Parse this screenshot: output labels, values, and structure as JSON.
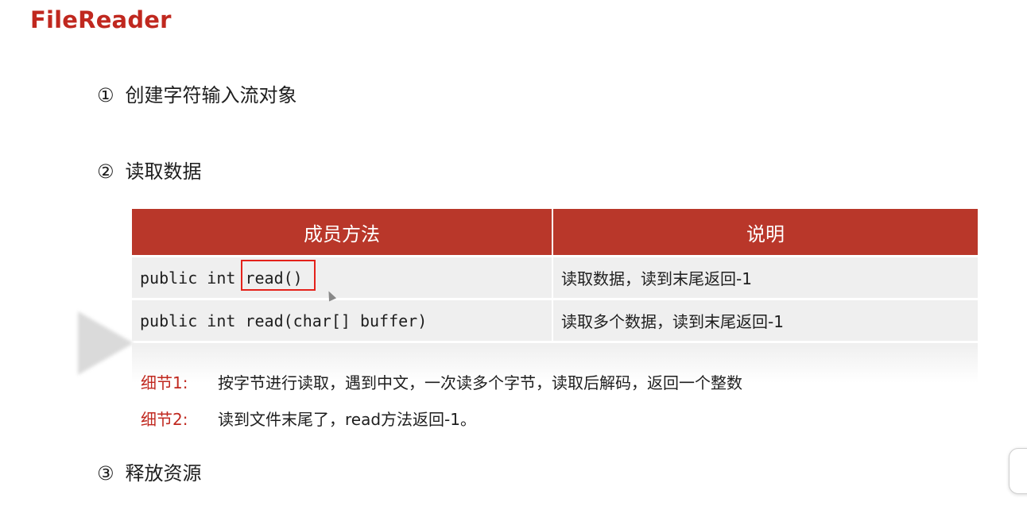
{
  "title": "FileReader",
  "steps": [
    {
      "num": "①",
      "text": "创建字符输入流对象"
    },
    {
      "num": "②",
      "text": "读取数据"
    },
    {
      "num": "③",
      "text": "释放资源"
    }
  ],
  "table": {
    "headers": [
      "成员方法",
      "说明"
    ],
    "rows": [
      {
        "method_prefix": "public int ",
        "method_highlight": "read()",
        "desc": "读取数据，读到末尾返回-1"
      },
      {
        "method_prefix": "public int read(char[] buffer)",
        "method_highlight": "",
        "desc": "读取多个数据，读到末尾返回-1"
      }
    ]
  },
  "details": [
    {
      "label": "细节1:",
      "text": "按字节进行读取，遇到中文，一次读多个字节，读取后解码，返回一个整数"
    },
    {
      "label": "细节2:",
      "text": "读到文件末尾了，read方法返回-1。"
    }
  ],
  "colors": {
    "accent": "#c0281f",
    "header_bg": "#b9372a",
    "row_bg": "#efefef",
    "highlight_box": "#e4221b"
  }
}
